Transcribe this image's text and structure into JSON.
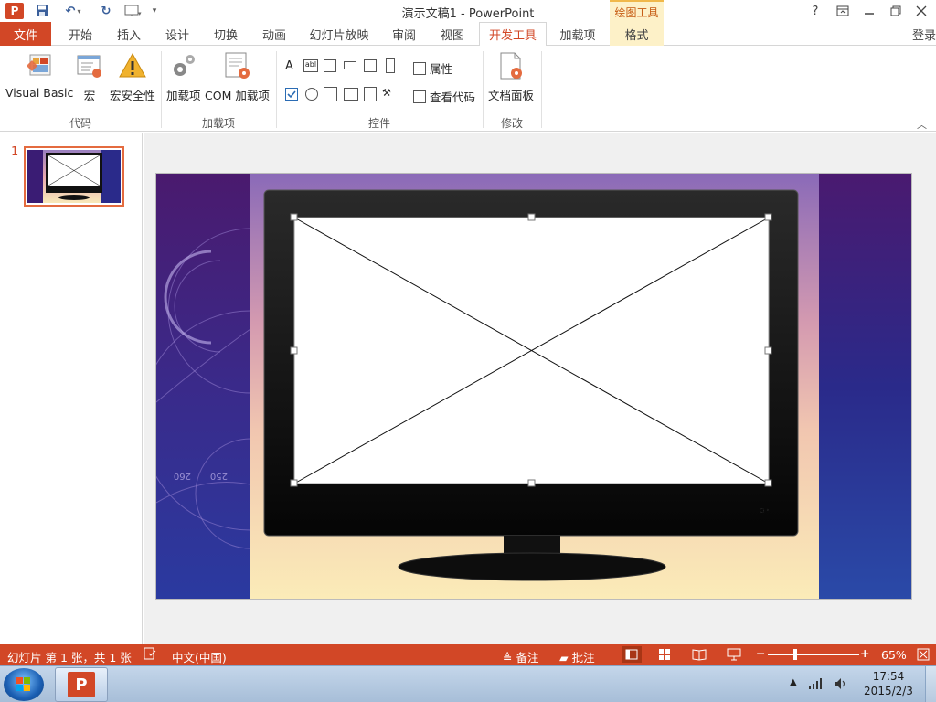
{
  "app": {
    "title": "演示文稿1 - PowerPoint",
    "logo_letter": "P",
    "drawing_tools": "绘图工具",
    "login": "登录",
    "help": "?",
    "undo_symbol": "↶",
    "redo_symbol": "↻"
  },
  "tabs": [
    {
      "label": "文件"
    },
    {
      "label": "开始"
    },
    {
      "label": "插入"
    },
    {
      "label": "设计"
    },
    {
      "label": "切换"
    },
    {
      "label": "动画"
    },
    {
      "label": "幻灯片放映"
    },
    {
      "label": "审阅"
    },
    {
      "label": "视图"
    },
    {
      "label": "开发工具"
    },
    {
      "label": "加载项"
    },
    {
      "label": "格式"
    }
  ],
  "ribbon": {
    "groups": {
      "code": "代码",
      "addins": "加载项",
      "controls": "控件",
      "modify": "修改"
    },
    "buttons": {
      "visual_basic": "Visual Basic",
      "macro": "宏",
      "macro_security": "宏安全性",
      "addins": "加载项",
      "com_addins": "COM 加载项",
      "properties": "属性",
      "view_code": "查看代码",
      "document_panel": "文档面板"
    }
  },
  "thumbnails": [
    {
      "number": "1"
    }
  ],
  "statusbar": {
    "slide_info": "幻灯片 第 1 张，共 1 张",
    "language": "中文(中国)",
    "notes": "备注",
    "comments": "批注",
    "zoom": "65%"
  },
  "taskbar": {
    "time": "17:54",
    "date": "2015/2/3"
  },
  "slide": {
    "dial_numbers": [
      "260",
      "250"
    ]
  },
  "colors": {
    "accent": "#d24726",
    "drawing_tools_bg": "#fdf1c8",
    "drawing_tools_text": "#c55a11"
  }
}
